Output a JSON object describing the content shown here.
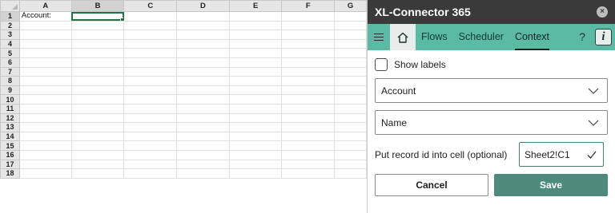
{
  "sheet": {
    "columns": [
      "A",
      "B",
      "C",
      "D",
      "E",
      "F",
      "G"
    ],
    "rows": [
      "1",
      "2",
      "3",
      "4",
      "5",
      "6",
      "7",
      "8",
      "9",
      "10",
      "11",
      "12",
      "13",
      "14",
      "15",
      "16",
      "17",
      "18"
    ],
    "cell_A1": "Account:"
  },
  "panel": {
    "title": "XL-Connector 365",
    "close_icon": "×",
    "nav": {
      "tabs": [
        "Flows",
        "Scheduler",
        "Context"
      ],
      "help_icon": "?",
      "info_icon": "i"
    },
    "show_labels": "Show labels",
    "select_object": "Account",
    "select_field": "Name",
    "record_label": "Put record id into cell (optional)",
    "record_value": "Sheet2!C1",
    "cancel_label": "Cancel",
    "save_label": "Save"
  },
  "colors": {
    "nav_bg": "#5bbaa4",
    "title_bg": "#3a3a3a",
    "save_bg": "#4e8b7c",
    "selection": "#217346"
  }
}
